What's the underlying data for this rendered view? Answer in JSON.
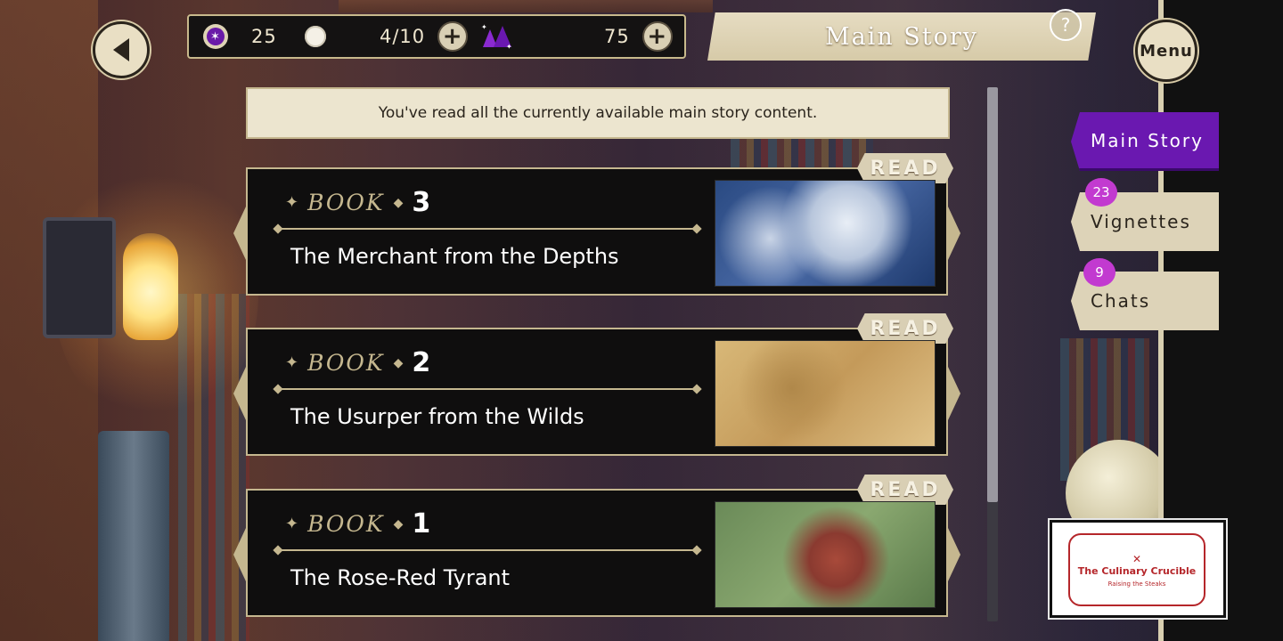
{
  "top_bar": {
    "gems": "25",
    "cookies": "4/10",
    "crystals": "75"
  },
  "header": {
    "title": "Main Story",
    "help_label": "?",
    "menu_label": "Menu"
  },
  "notice": "You've read all the currently available main story content.",
  "books": [
    {
      "word": "BOOK",
      "number": "3",
      "title": "The Merchant from the Depths",
      "status": "READ"
    },
    {
      "word": "BOOK",
      "number": "2",
      "title": "The Usurper from the Wilds",
      "status": "READ"
    },
    {
      "word": "BOOK",
      "number": "1",
      "title": "The Rose-Red Tyrant",
      "status": "READ"
    }
  ],
  "side_tabs": [
    {
      "label": "Main Story",
      "active": true
    },
    {
      "label": "Vignettes",
      "badge": "23"
    },
    {
      "label": "Chats",
      "badge": "9"
    }
  ],
  "event_banner": {
    "title": "The Culinary Crucible",
    "subtitle": "Raising the Steaks"
  },
  "colors": {
    "accent_purple": "#6a18b0",
    "badge_magenta": "#c23ad0",
    "gold": "#c5b78f",
    "card_bg": "#0f0e0e"
  },
  "scroll_position": 0
}
